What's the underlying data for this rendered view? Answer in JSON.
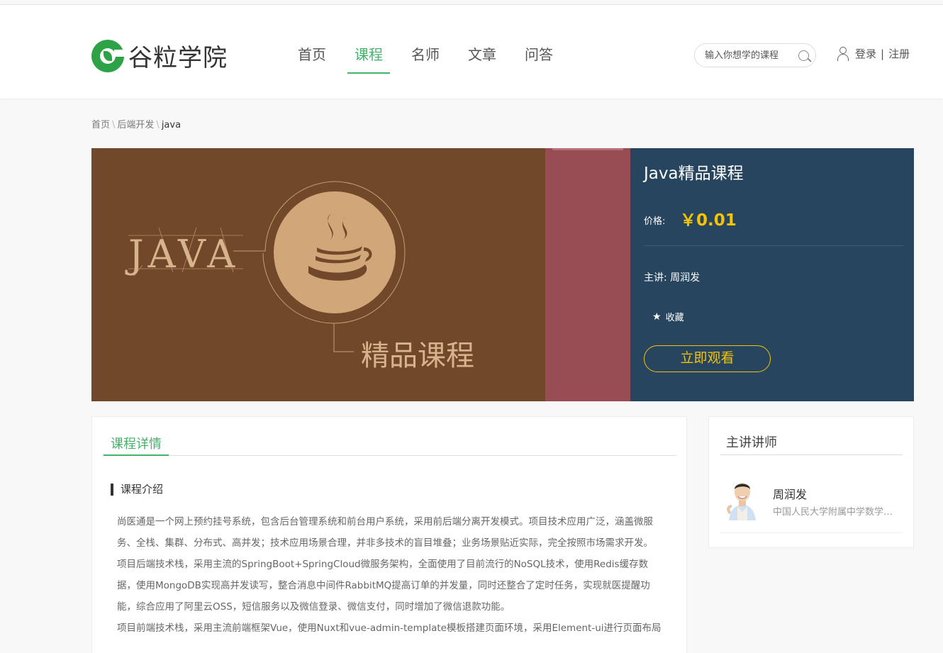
{
  "header": {
    "logo_text": "谷粒学院",
    "nav": [
      {
        "label": "首页",
        "active": false
      },
      {
        "label": "课程",
        "active": true
      },
      {
        "label": "名师",
        "active": false
      },
      {
        "label": "文章",
        "active": false
      },
      {
        "label": "问答",
        "active": false
      }
    ],
    "search": {
      "placeholder": "输入你想学的课程",
      "icon": "search-icon"
    },
    "user": {
      "icon": "user-icon",
      "login": "登录",
      "separator": "|",
      "register": "注册"
    }
  },
  "breadcrumb": {
    "items": [
      "首页",
      "后端开发",
      "java"
    ],
    "separator": "\\"
  },
  "cover": {
    "java_text": "JAVA",
    "subtitle": "精品课程"
  },
  "course": {
    "title": "Java精品课程",
    "price_label": "价格:",
    "price": "￥0.01",
    "teacher_label": "主讲:",
    "teacher_name": "周润发",
    "favorite_label": "收藏",
    "favorite_icon": "star-icon",
    "watch_label": "立即观看"
  },
  "detail": {
    "tab_label": "课程详情",
    "section_title": "课程介绍",
    "paragraphs": [
      "尚医通是一个网上预约挂号系统，包含后台管理系统和前台用户系统，采用前后端分离开发模式。项目技术应用广泛，涵盖微服务、全栈、集群、分布式、高并发；技术应用场景合理，并非多技术的盲目堆叠；业务场景贴近实际，完全按照市场需求开发。",
      "项目后端技术栈，采用主流的SpringBoot+SpringCloud微服务架构，全面使用了目前流行的NoSQL技术，使用Redis缓存数据，使用MongoDB实现高并发读写，整合消息中间件RabbitMQ提高订单的并发量，同时还整合了定时任务，实现就医提醒功能，综合应用了阿里云OSS，短信服务以及微信登录、微信支付，同时增加了微信退款功能。",
      "项目前端技术栈，采用主流前端框架Vue，使用Nuxt和vue-admin-template模板搭建页面环境，采用Element-ui进行页面布局"
    ]
  },
  "sidebar": {
    "title": "主讲讲师",
    "teacher": {
      "name": "周润发",
      "description": "中国人民大学附属中学数学一级教师"
    }
  },
  "colors": {
    "brand_green": "#44b26b",
    "price_yellow": "#f5c400",
    "info_panel": "#27455e",
    "cover_brown": "#714829",
    "stripe_red": "#974d53"
  }
}
